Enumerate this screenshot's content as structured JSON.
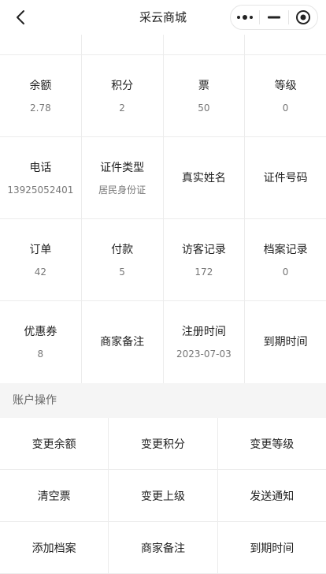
{
  "navbar": {
    "title": "采云商城"
  },
  "stats": [
    [
      {
        "label": "余额",
        "value": "2.78"
      },
      {
        "label": "积分",
        "value": "2"
      },
      {
        "label": "票",
        "value": "50"
      },
      {
        "label": "等级",
        "value": "0"
      }
    ],
    [
      {
        "label": "电话",
        "value": "13925052401"
      },
      {
        "label": "证件类型",
        "value": "居民身份证"
      },
      {
        "label": "真实姓名",
        "value": ""
      },
      {
        "label": "证件号码",
        "value": ""
      }
    ],
    [
      {
        "label": "订单",
        "value": "42"
      },
      {
        "label": "付款",
        "value": "5"
      },
      {
        "label": "访客记录",
        "value": "172"
      },
      {
        "label": "档案记录",
        "value": "0"
      }
    ],
    [
      {
        "label": "优惠券",
        "value": "8"
      },
      {
        "label": "商家备注",
        "value": ""
      },
      {
        "label": "注册时间",
        "value": "2023-07-03"
      },
      {
        "label": "到期时间",
        "value": ""
      }
    ]
  ],
  "account_section": {
    "title": "账户操作"
  },
  "actions": [
    [
      "变更余额",
      "变更积分",
      "变更等级"
    ],
    [
      "清空票",
      "变更上级",
      "发送通知"
    ],
    [
      "添加档案",
      "商家备注",
      "到期时间"
    ]
  ]
}
